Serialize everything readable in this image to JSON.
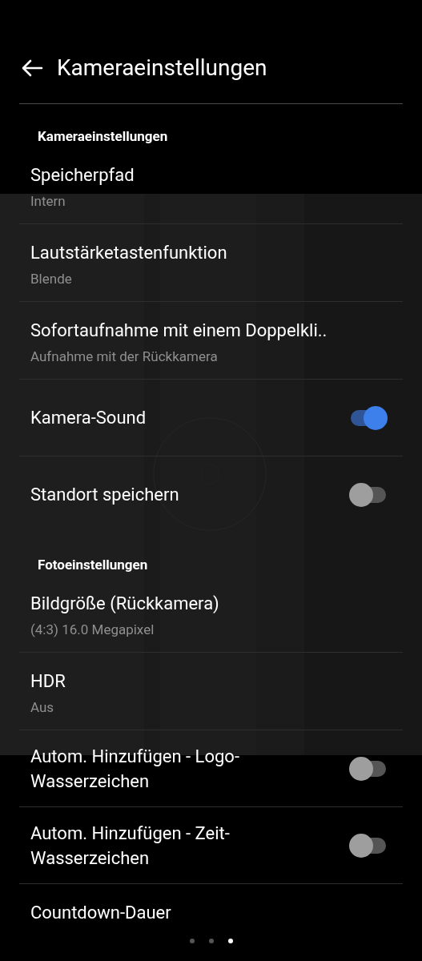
{
  "header": {
    "title": "Kameraeinstellungen"
  },
  "sections": [
    {
      "title": "Kameraeinstellungen",
      "rows": [
        {
          "kind": "nav",
          "title": "Speicherpfad",
          "subtitle": "Intern"
        },
        {
          "kind": "nav",
          "title": "Lautstärketastenfunktion",
          "subtitle": "Blende"
        },
        {
          "kind": "nav",
          "title": "Sofortaufnahme mit einem Doppelkli..",
          "subtitle": "Aufnahme mit der Rückkamera"
        },
        {
          "kind": "toggle",
          "title": "Kamera-Sound",
          "on": true
        },
        {
          "kind": "toggle",
          "title": "Standort speichern",
          "on": false
        }
      ]
    },
    {
      "title": "Fotoeinstellungen",
      "rows": [
        {
          "kind": "nav",
          "title": "Bildgröße (Rückkamera)",
          "subtitle": "(4:3) 16.0 Megapixel"
        },
        {
          "kind": "nav",
          "title": "HDR",
          "subtitle": "Aus"
        },
        {
          "kind": "toggle",
          "title": "Autom. Hinzufügen - Logo-Wasserzeichen",
          "on": false
        },
        {
          "kind": "toggle",
          "title": "Autom. Hinzufügen - Zeit-Wasserzeichen",
          "on": false
        },
        {
          "kind": "nav",
          "title": "Countdown-Dauer"
        }
      ]
    }
  ],
  "page_indicator": [
    {
      "selected": false
    },
    {
      "selected": false
    },
    {
      "selected": true
    }
  ]
}
